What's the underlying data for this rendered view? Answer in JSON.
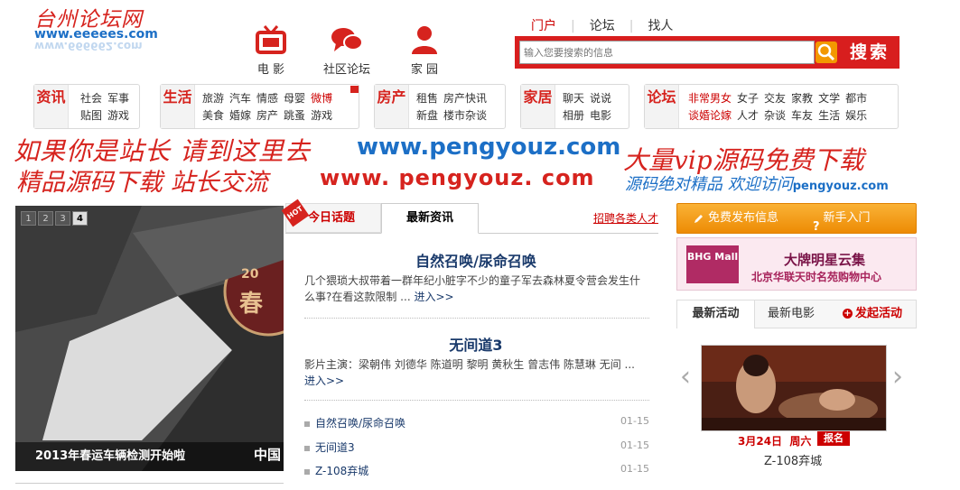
{
  "logo": {
    "title": "台州论坛网",
    "url": "www.eeeees.com",
    "url_mirror": "www.666662.com"
  },
  "header_nav": [
    {
      "label": "电 影",
      "icon": "tv-icon"
    },
    {
      "label": "社区论坛",
      "icon": "chat-bubbles-icon"
    },
    {
      "label": "家 园",
      "icon": "person-icon"
    }
  ],
  "top_nav": {
    "portal": "门户",
    "forum": "论坛",
    "find_people": "找人"
  },
  "search": {
    "placeholder": "输入您要搜索的信息",
    "button": "搜索"
  },
  "categories": [
    {
      "label": "资讯",
      "links": [
        [
          "社会",
          "军事"
        ],
        [
          "贴图",
          "游戏"
        ]
      ]
    },
    {
      "label": "生活",
      "links": [
        [
          "旅游",
          "汽车",
          "情感",
          "母婴",
          "微博"
        ],
        [
          "美食",
          "婚嫁",
          "房产",
          "跳蚤",
          "游戏"
        ]
      ]
    },
    {
      "label": "房产",
      "links": [
        [
          "租售",
          "房产快讯"
        ],
        [
          "新盘",
          "楼市杂谈"
        ]
      ]
    },
    {
      "label": "家居",
      "links": [
        [
          "聊天",
          "说说"
        ],
        [
          "相册",
          "电影"
        ]
      ]
    },
    {
      "label": "论坛",
      "links": [
        [
          "非常男女",
          "女子",
          "交友",
          "家教",
          "文学",
          "都市"
        ],
        [
          "谈婚论嫁",
          "人才",
          "杂谈",
          "车友",
          "生活",
          "娱乐"
        ]
      ]
    }
  ],
  "ad_banner": {
    "line1": "如果你是站长 请到这里去",
    "line1_url": "www.pengyouz.com",
    "line2": "精品源码下载 站长交流",
    "line2_url": "www. pengyouz. com",
    "right1": "大量vip源码免费下载",
    "right2": "源码绝对精品 欢迎访问",
    "right2_url": "pengyouz.com"
  },
  "slideshow": {
    "pages": [
      "1",
      "2",
      "3",
      "4"
    ],
    "active_page": "4",
    "caption": "2013年春运车辆检测开始啦",
    "watermark": "中国",
    "stamp": "20",
    "stamp2": "春"
  },
  "news_tabs": {
    "hot_badge": "HOT",
    "tab_today": "今日话题",
    "tab_latest": "最新资讯",
    "link": "招聘各类人才"
  },
  "news_items": [
    {
      "title": "自然召唤/尿命召唤",
      "desc": "几个猥琐大叔带着一群年纪小脏字不少的童子军去森林夏令营会发生什么事?在看这款限制 ...",
      "more": "进入>>"
    },
    {
      "title": "无间道3",
      "desc": "影片主演：梁朝伟 刘德华 陈道明 黎明 黄秋生 曾志伟 陈慧琳 无间 ...",
      "more": "进入>>"
    }
  ],
  "news_list": [
    {
      "title": "自然召唤/尿命召唤",
      "date": "01-15"
    },
    {
      "title": "无间道3",
      "date": "01-15"
    },
    {
      "title": "Z-108弃城",
      "date": "01-15"
    }
  ],
  "right": {
    "publish": "免费发布信息",
    "newbie": "新手入门",
    "mall": {
      "logo": "BHG Mall",
      "t1": "大牌明星云集",
      "t2": "北京华联天时名苑购物中心"
    },
    "tabs": {
      "activity": "最新活动",
      "movie": "最新电影",
      "launch": "发起活动"
    },
    "event": {
      "date": "3月24日",
      "weekday": "周六",
      "badge": "报名",
      "caption": "Z-108弃城"
    }
  },
  "colors": {
    "brand_red": "#d6231e",
    "link_blue": "#1a3a6b",
    "orange": "#f39800"
  }
}
